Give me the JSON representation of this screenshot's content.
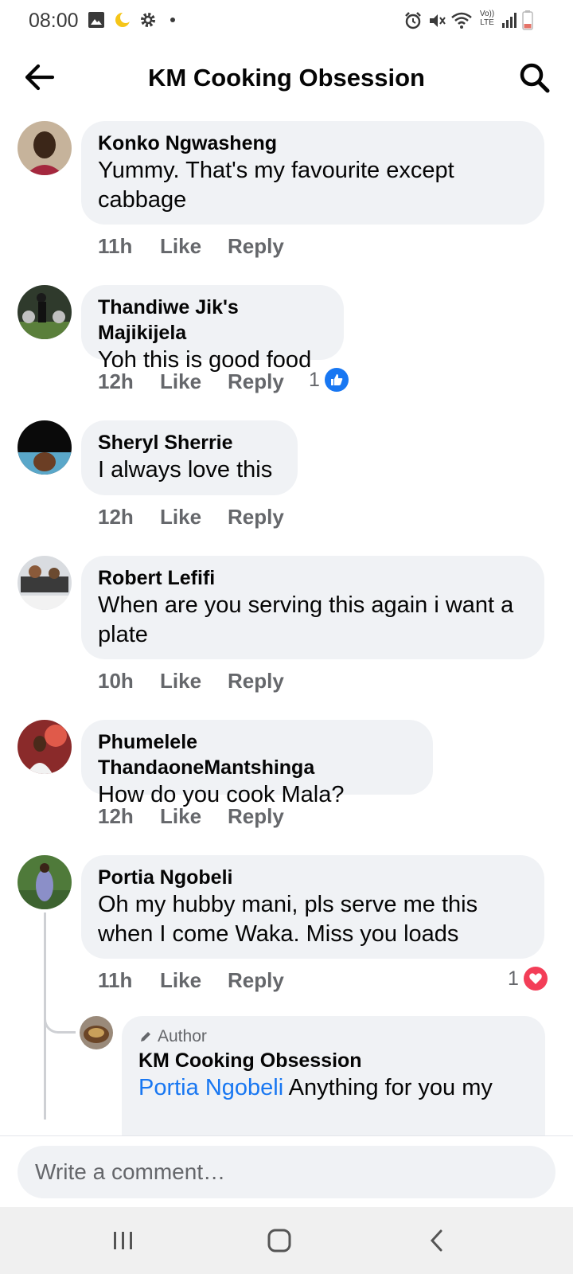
{
  "status_bar": {
    "time": "08:00",
    "left_icons": [
      "image-icon",
      "moon-icon",
      "gear-icon",
      "dot-icon"
    ],
    "right_icons": [
      "alarm-icon",
      "mute-icon",
      "wifi-icon",
      "volte-icon",
      "signal-icon",
      "battery-icon"
    ],
    "volte_label": "Vo)) LTE"
  },
  "header": {
    "title": "KM Cooking Obsession"
  },
  "actions": {
    "like": "Like",
    "reply": "Reply"
  },
  "comments": [
    {
      "name": "Konko Ngwasheng",
      "text_lines": [
        "Yummy. That's my favourite except",
        "cabbage"
      ],
      "time": "11h"
    },
    {
      "name": "Thandiwe Jik's Majikijela",
      "text_lines": [
        "Yoh this is good food"
      ],
      "time": "12h",
      "reaction_count": "1",
      "reaction": "like"
    },
    {
      "name": "Sheryl Sherrie",
      "text_lines": [
        "I always love this"
      ],
      "time": "12h"
    },
    {
      "name": "Robert Lefifi",
      "text_lines": [
        "When are you serving this again i want a",
        "plate"
      ],
      "time": "10h"
    },
    {
      "name": "Phumelele ThandaoneMantshinga",
      "text_lines": [
        "How do you cook Mala?"
      ],
      "time": "12h"
    },
    {
      "name": "Portia Ngobeli",
      "text_lines": [
        "Oh my hubby mani, pls serve me this",
        "when I come Waka. Miss you loads"
      ],
      "time": "11h",
      "reaction_count": "1",
      "reaction": "love"
    }
  ],
  "reply": {
    "badge": "Author",
    "name": "KM Cooking Obsession",
    "mention": "Portia Ngobeli",
    "text": " Anything for you my"
  },
  "composer": {
    "placeholder": "Write a comment…"
  },
  "colors": {
    "accent": "#1877f2",
    "bubble": "#f0f2f5",
    "secondary_text": "#65676b",
    "love": "#f33e58"
  }
}
